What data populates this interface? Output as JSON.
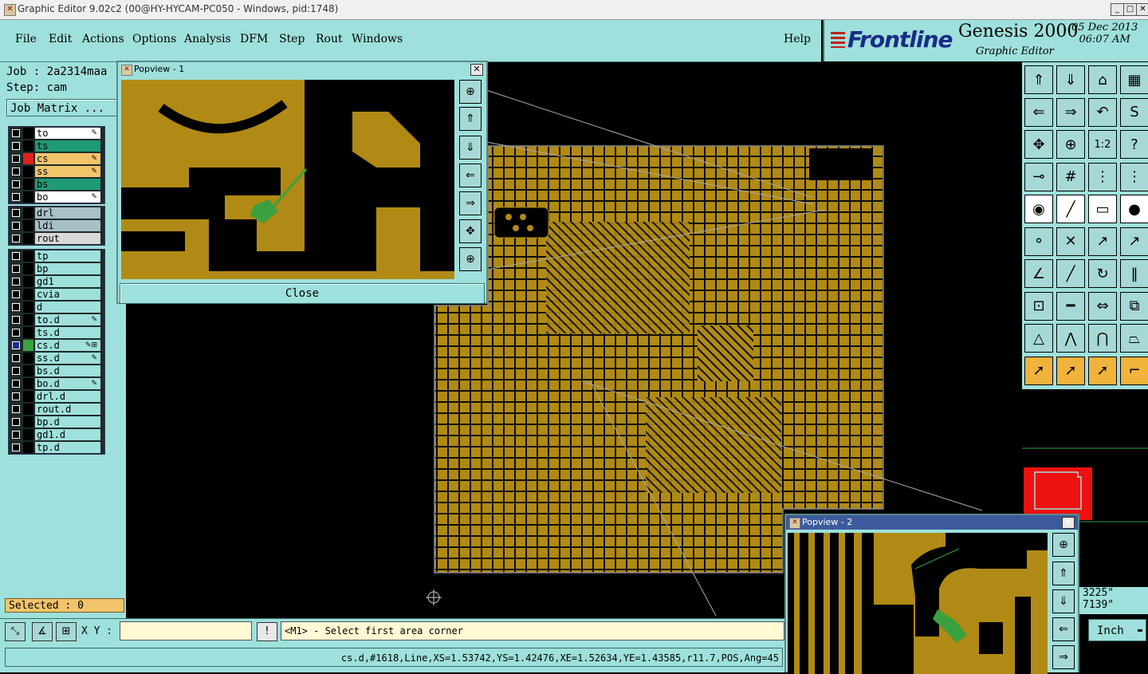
{
  "window": {
    "title": "Graphic Editor 9.02c2 (00@HY-HYCAM-PC050 - Windows, pid:1748)",
    "min": "_",
    "max": "□",
    "close": "✕"
  },
  "menu": [
    "File",
    "Edit",
    "Actions",
    "Options",
    "Analysis",
    "DFM",
    "Step",
    "Rout",
    "Windows"
  ],
  "help_label": "Help",
  "brand": {
    "logo": "Frontline",
    "product": "Genesis 2000",
    "subtitle": "Graphic Editor",
    "date": "05 Dec 2013",
    "time": "06:07 AM"
  },
  "job": {
    "job_label": "Job : 2a2314maa",
    "step_label": "Step: cam",
    "matrix_button": "Job Matrix ..."
  },
  "layer_groups": [
    [
      {
        "name": "to",
        "bg": "#ffffff",
        "color": "#000000",
        "mark": "✎",
        "checked": false
      },
      {
        "name": "ts",
        "bg": "#1f9a76",
        "color": "#000000",
        "mark": "",
        "checked": false
      },
      {
        "name": "cs",
        "bg": "#f2c46a",
        "color": "#e0201a",
        "mark": "✎",
        "checked": false
      },
      {
        "name": "ss",
        "bg": "#f2c46a",
        "color": "#000000",
        "mark": "✎",
        "checked": false
      },
      {
        "name": "bs",
        "bg": "#1f9a76",
        "color": "#000000",
        "mark": "",
        "checked": false
      },
      {
        "name": "bo",
        "bg": "#ffffff",
        "color": "#000000",
        "mark": "✎",
        "checked": false
      }
    ],
    [
      {
        "name": "drl",
        "bg": "#a8c0c8",
        "color": "#000000",
        "mark": "",
        "checked": false
      },
      {
        "name": "ldi",
        "bg": "#a8c0c8",
        "color": "#000000",
        "mark": "",
        "checked": false
      },
      {
        "name": "rout",
        "bg": "#d8d8d8",
        "color": "#000000",
        "mark": "",
        "checked": false
      }
    ],
    [
      {
        "name": "tp",
        "bg": "#9ee0dc",
        "color": "#000000",
        "mark": "",
        "checked": false
      },
      {
        "name": "bp",
        "bg": "#9ee0dc",
        "color": "#000000",
        "mark": "",
        "checked": false
      },
      {
        "name": "gd1",
        "bg": "#9ee0dc",
        "color": "#000000",
        "mark": "",
        "checked": false
      },
      {
        "name": "cvia",
        "bg": "#9ee0dc",
        "color": "#000000",
        "mark": "",
        "checked": false
      },
      {
        "name": "d",
        "bg": "#9ee0dc",
        "color": "#000000",
        "mark": "",
        "checked": false
      },
      {
        "name": "to.d",
        "bg": "#9ee0dc",
        "color": "#000000",
        "mark": "✎",
        "checked": false
      },
      {
        "name": "ts.d",
        "bg": "#9ee0dc",
        "color": "#000000",
        "mark": "",
        "checked": false
      },
      {
        "name": "cs.d",
        "bg": "#9ee0dc",
        "color": "#3aa040",
        "mark": "✎⊞",
        "checked": true
      },
      {
        "name": "ss.d",
        "bg": "#9ee0dc",
        "color": "#000000",
        "mark": "✎",
        "checked": false
      },
      {
        "name": "bs.d",
        "bg": "#9ee0dc",
        "color": "#000000",
        "mark": "",
        "checked": false
      },
      {
        "name": "bo.d",
        "bg": "#9ee0dc",
        "color": "#000000",
        "mark": "✎",
        "checked": false
      },
      {
        "name": "drl.d",
        "bg": "#9ee0dc",
        "color": "#000000",
        "mark": "",
        "checked": false
      },
      {
        "name": "rout.d",
        "bg": "#9ee0dc",
        "color": "#000000",
        "mark": "",
        "checked": false
      },
      {
        "name": "bp.d",
        "bg": "#9ee0dc",
        "color": "#000000",
        "mark": "",
        "checked": false
      },
      {
        "name": "gd1.d",
        "bg": "#9ee0dc",
        "color": "#000000",
        "mark": "",
        "checked": false
      },
      {
        "name": "tp.d",
        "bg": "#9ee0dc",
        "color": "#000000",
        "mark": "",
        "checked": false
      }
    ]
  ],
  "selected_label": "Selected : 0",
  "command": {
    "xy_label": "X Y :",
    "xy_value": "",
    "excl": "!",
    "prompt": "<M1> - Select first area corner"
  },
  "status_text": "cs.d,#1618,Line,XS=1.53742,YS=1.42476,XE=1.52634,YE=1.43585,r11.7,POS,Ang=45",
  "coords": {
    "x": "3225\"",
    "y": "7139\""
  },
  "units": "Inch",
  "popview1": {
    "title": "Popview - 1",
    "close_label": "Close"
  },
  "popview2": {
    "title": "Popview - 2"
  },
  "tools": [
    {
      "icon": "page-up-icon",
      "glyph": "⇑",
      "style": ""
    },
    {
      "icon": "page-down-icon",
      "glyph": "⇓",
      "style": ""
    },
    {
      "icon": "home-icon",
      "glyph": "⌂",
      "style": ""
    },
    {
      "icon": "split-view-icon",
      "glyph": "▦",
      "style": ""
    },
    {
      "icon": "pan-left-icon",
      "glyph": "⇐",
      "style": ""
    },
    {
      "icon": "pan-right-icon",
      "glyph": "⇒",
      "style": ""
    },
    {
      "icon": "undo-zoom-icon",
      "glyph": "↶",
      "style": ""
    },
    {
      "icon": "redraw-icon",
      "glyph": "S",
      "style": ""
    },
    {
      "icon": "zoom-fit-icon",
      "glyph": "✥",
      "style": ""
    },
    {
      "icon": "zoom-center-icon",
      "glyph": "⊕",
      "style": ""
    },
    {
      "icon": "zoom-ratio-icon",
      "glyph": "1:2",
      "style": ""
    },
    {
      "icon": "help-icon",
      "glyph": "?",
      "style": ""
    },
    {
      "icon": "ruler-icon",
      "glyph": "⊸",
      "style": ""
    },
    {
      "icon": "grid-icon",
      "glyph": "#",
      "style": ""
    },
    {
      "icon": "net-highlight-icon",
      "glyph": "⋮",
      "style": ""
    },
    {
      "icon": "net-select-icon",
      "glyph": "⋮",
      "style": ""
    },
    {
      "icon": "pad-snap-icon",
      "glyph": "◉",
      "style": "w"
    },
    {
      "icon": "line-draw-icon",
      "glyph": "╱",
      "style": "w"
    },
    {
      "icon": "measure-icon",
      "glyph": "▭",
      "style": "w"
    },
    {
      "icon": "point-icon",
      "glyph": "●",
      "style": "w"
    },
    {
      "icon": "connect-icon",
      "glyph": "⚬",
      "style": ""
    },
    {
      "icon": "cross-icon",
      "glyph": "✕",
      "style": ""
    },
    {
      "icon": "move-point-icon",
      "glyph": "↗",
      "style": ""
    },
    {
      "icon": "extend-icon",
      "glyph": "↗",
      "style": ""
    },
    {
      "icon": "angle-icon",
      "glyph": "∠",
      "style": ""
    },
    {
      "icon": "slope-icon",
      "glyph": "╱",
      "style": ""
    },
    {
      "icon": "arc-icon",
      "glyph": "↻",
      "style": ""
    },
    {
      "icon": "mirror-icon",
      "glyph": "‖",
      "style": ""
    },
    {
      "icon": "pad-edit-icon",
      "glyph": "⊡",
      "style": ""
    },
    {
      "icon": "line-edit-icon",
      "glyph": "━",
      "style": ""
    },
    {
      "icon": "width-icon",
      "glyph": "⇔",
      "style": ""
    },
    {
      "icon": "group-icon",
      "glyph": "⧉",
      "style": ""
    },
    {
      "icon": "triangle-icon",
      "glyph": "△",
      "style": ""
    },
    {
      "icon": "peak-icon",
      "glyph": "⋀",
      "style": ""
    },
    {
      "icon": "arch-icon",
      "glyph": "⋂",
      "style": ""
    },
    {
      "icon": "trapezoid-icon",
      "glyph": "⏢",
      "style": ""
    },
    {
      "icon": "pointer-icon",
      "glyph": "➚",
      "style": "o"
    },
    {
      "icon": "select-icon",
      "glyph": "➚",
      "style": "o"
    },
    {
      "icon": "rotate-select-icon",
      "glyph": "➚",
      "style": "o"
    },
    {
      "icon": "route-select-icon",
      "glyph": "⌐",
      "style": "o"
    }
  ]
}
